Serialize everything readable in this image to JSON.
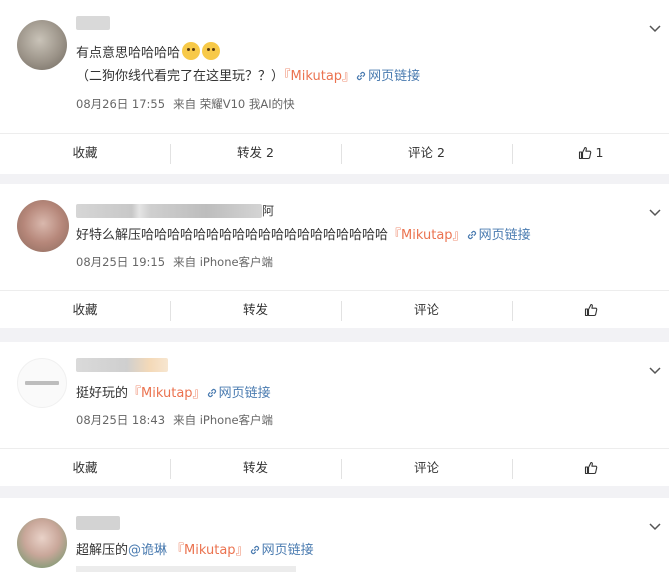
{
  "posts": [
    {
      "text_parts": {
        "line1": "有点意思哈哈哈哈",
        "line2_prefix": "（二狗你线代看完了在这里玩？？）",
        "bracket_open": "『",
        "keyword": "Mikutap",
        "bracket_close": "』",
        "link": "网页链接"
      },
      "date": "08月26日 17:55",
      "source": "来自 荣耀V10 我AI的快",
      "actions": {
        "favorite": "收藏",
        "repost": "转发 2",
        "comment": "评论 2",
        "like_count": "1"
      }
    },
    {
      "username_tail": "阿",
      "text_parts": {
        "prefix": "好特么解压哈哈哈哈哈哈哈哈哈哈哈哈哈哈哈哈哈哈哈",
        "bracket_open": "『",
        "keyword": "Mikutap",
        "bracket_close": "』",
        "link": "网页链接"
      },
      "date": "08月25日 19:15",
      "source": "来自 iPhone客户端",
      "actions": {
        "favorite": "收藏",
        "repost": "转发",
        "comment": "评论",
        "like_count": ""
      }
    },
    {
      "text_parts": {
        "prefix": "挺好玩的",
        "bracket_open": "『",
        "keyword": "Mikutap",
        "bracket_close": "』",
        "link": "网页链接"
      },
      "date": "08月25日 18:43",
      "source": "来自 iPhone客户端",
      "actions": {
        "favorite": "收藏",
        "repost": "转发",
        "comment": "评论",
        "like_count": ""
      }
    },
    {
      "text_parts": {
        "prefix": "超解压的",
        "mention": "@诡琳",
        "bracket_open": "『",
        "keyword": "Mikutap",
        "bracket_close": "』",
        "link": "网页链接"
      }
    }
  ],
  "colors": {
    "keyword": "#eb7350",
    "link": "#4a7bb0",
    "background": "#f2f2f5"
  },
  "icons": {
    "expand": "chevron-down-icon",
    "link": "link-icon",
    "like": "thumbs-up-icon"
  }
}
